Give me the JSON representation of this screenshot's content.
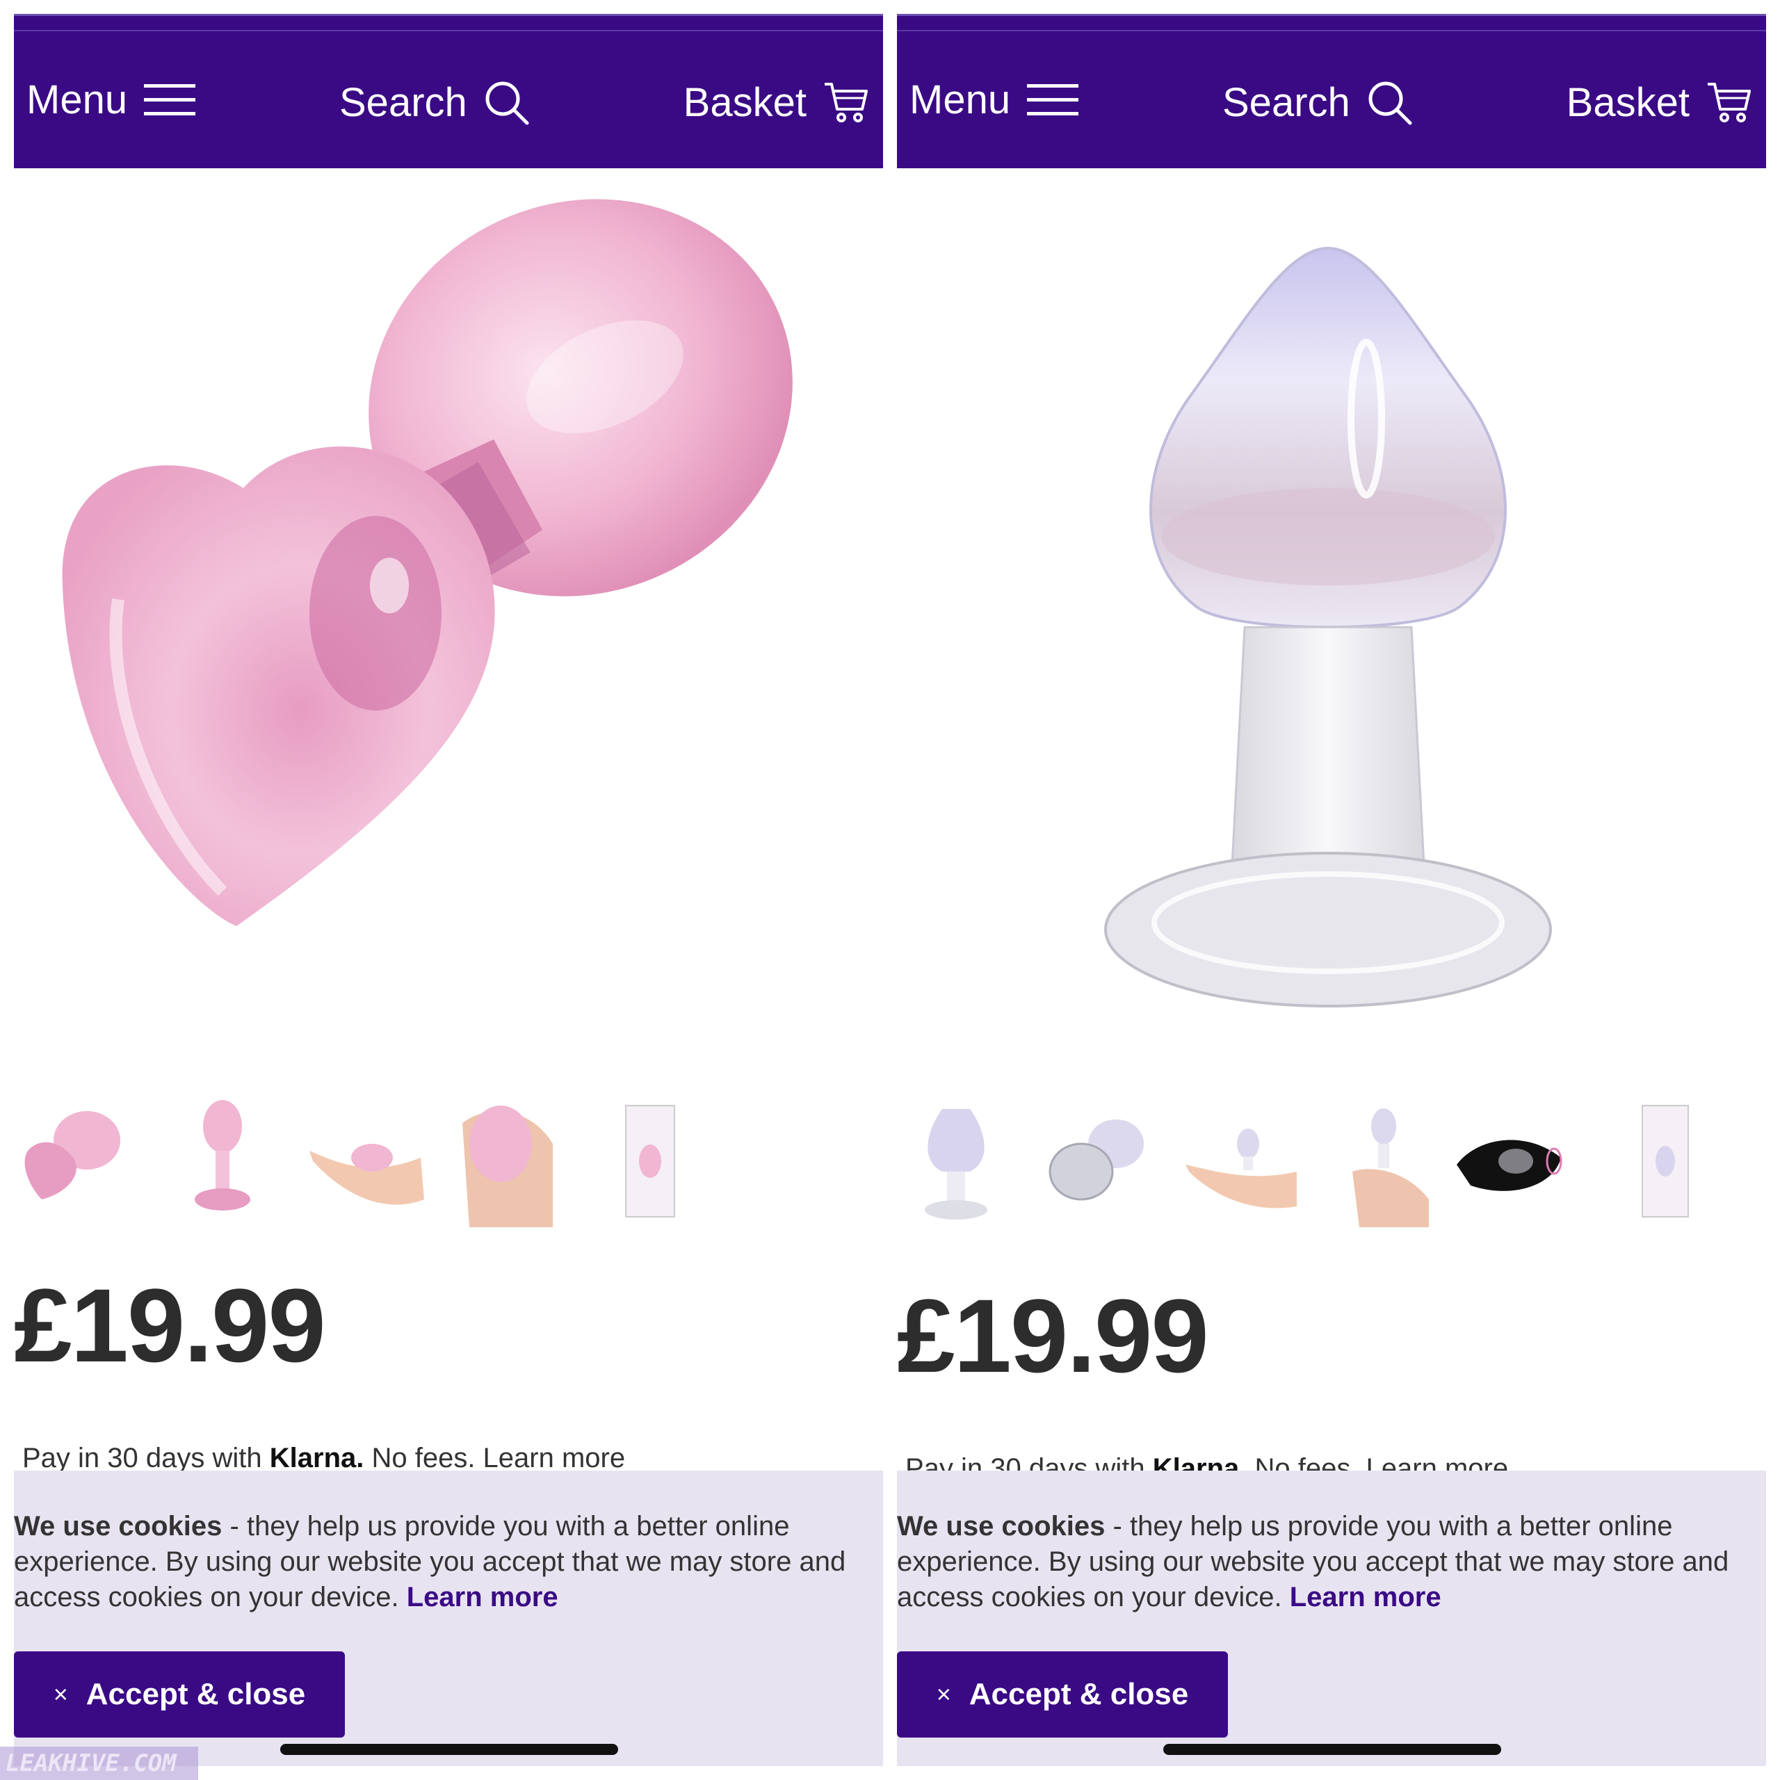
{
  "nav": {
    "menu_label": "Menu",
    "search_label": "Search",
    "basket_label": "Basket",
    "color": "#3a0a85"
  },
  "panels": [
    {
      "product_image": "pink-glass-heart-base-plug",
      "thumbnails": [
        "heart-plug-side",
        "heart-plug-upright",
        "heart-plug-in-palm",
        "heart-plug-in-hand",
        "product-box"
      ],
      "price": "£19.99",
      "klarna": {
        "prefix": "Pay in 30 days with ",
        "brand": "Klarna.",
        "suffix": " No fees. Learn more"
      }
    },
    {
      "product_image": "clear-glass-plug-round-base",
      "thumbnails": [
        "clear-plug-upright",
        "clear-plug-side",
        "clear-plug-in-palm",
        "clear-plug-in-hand",
        "black-pouch",
        "product-box"
      ],
      "price": "£19.99",
      "klarna": {
        "prefix": "Pay in 30 days with ",
        "brand": "Klarna.",
        "suffix": " No fees. Learn more"
      }
    }
  ],
  "cookie": {
    "strong": "We use cookies",
    "text": " - they help us provide you with a better online experience. By using our website you accept that we may store and access cookies on your device. ",
    "link": "Learn more",
    "button_icon": "×",
    "button_label": "Accept & close",
    "background": "#e8e3f1"
  },
  "watermark": "LEAKHIVE.COM"
}
